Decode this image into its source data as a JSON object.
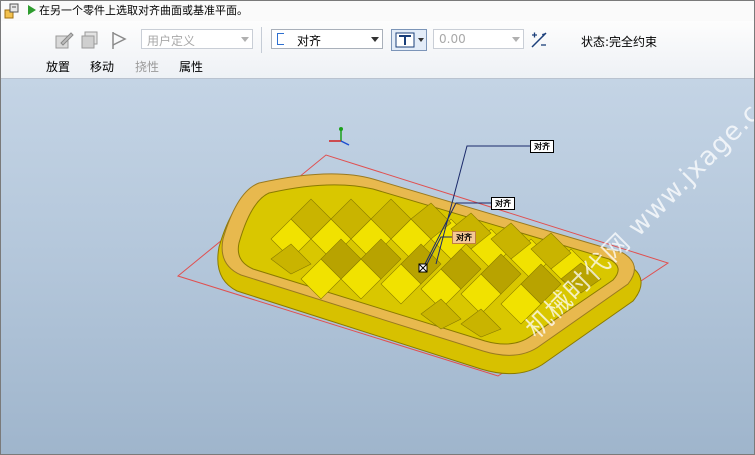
{
  "message": {
    "text": "在另一个零件上选取对齐曲面或基准平面。"
  },
  "dashboard": {
    "offset_type": "用户定义",
    "constraint_type": "对齐",
    "offset_value": "0.00",
    "tabs": {
      "placement": "放置",
      "move": "移动",
      "flexibility": "挠性",
      "properties": "属性"
    },
    "status": "状态:完全约束"
  },
  "viewport": {
    "tags": {
      "tag1": "对齐",
      "tag2": "对齐",
      "tag3": "对齐"
    },
    "watermark": "机械时代网 www.jxage.com",
    "colors": {
      "part": "#e6cf00",
      "rim": "#e8b94e",
      "datum": "#e05050",
      "background_top": "#c4d4e5",
      "background_bottom": "#9fb5cc"
    }
  },
  "icons": {
    "message": "assembly-message-icon",
    "arrow": "green-arrow-icon",
    "btn1": "edit-component-icon",
    "btn2": "copy-component-icon",
    "btn3": "flag-icon",
    "constraint": "constraint-mode-icon",
    "flip": "flip-offset-icon"
  }
}
